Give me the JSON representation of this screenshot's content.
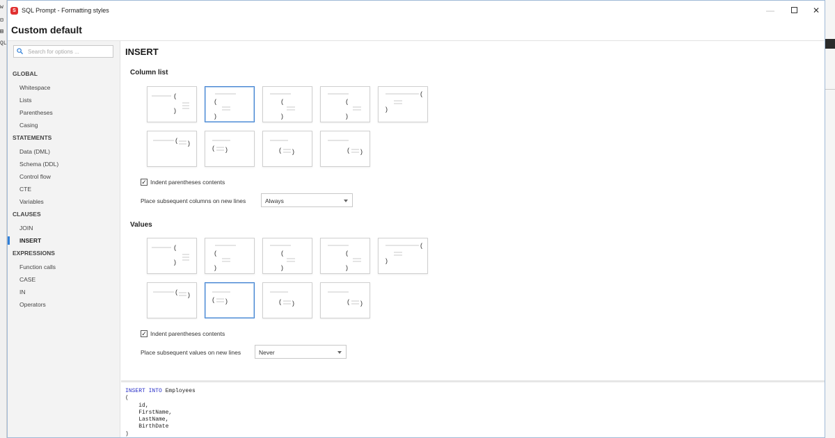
{
  "window": {
    "title": "SQL Prompt - Formatting styles",
    "style_name": "Custom default"
  },
  "search": {
    "placeholder": "Search for options ..."
  },
  "sidebar": {
    "sections": [
      {
        "heading": "GLOBAL",
        "items": [
          "Whitespace",
          "Lists",
          "Parentheses",
          "Casing"
        ]
      },
      {
        "heading": "STATEMENTS",
        "items": [
          "Data (DML)",
          "Schema (DDL)",
          "Control flow",
          "CTE",
          "Variables"
        ]
      },
      {
        "heading": "CLAUSES",
        "items": [
          "JOIN",
          "INSERT"
        ]
      },
      {
        "heading": "EXPRESSIONS",
        "items": [
          "Function calls",
          "CASE",
          "IN",
          "Operators"
        ]
      }
    ],
    "active_item": "INSERT"
  },
  "page": {
    "title": "INSERT",
    "column_list": {
      "title": "Column list",
      "selected_option": 2,
      "indent_label": "Indent parentheses contents",
      "indent_checked": true,
      "subsequent_label": "Place subsequent columns on new lines",
      "subsequent_value": "Always"
    },
    "values": {
      "title": "Values",
      "selected_option": 7,
      "indent_label": "Indent parentheses contents",
      "indent_checked": true,
      "subsequent_label": "Place subsequent values on new lines",
      "subsequent_value": "Never"
    }
  },
  "preview": {
    "lines": [
      [
        {
          "t": "INSERT INTO",
          "kw": true
        },
        {
          "t": " Employees"
        }
      ],
      [
        {
          "t": "("
        }
      ],
      [
        {
          "t": "    id,"
        }
      ],
      [
        {
          "t": "    FirstName,"
        }
      ],
      [
        {
          "t": "    LastName,"
        }
      ],
      [
        {
          "t": "    BirthDate"
        }
      ],
      [
        {
          "t": ")"
        }
      ]
    ]
  },
  "colors": {
    "accent": "#2f7fd8",
    "keyword": "#2a30c8",
    "selected_border": "#3d7fd0"
  }
}
